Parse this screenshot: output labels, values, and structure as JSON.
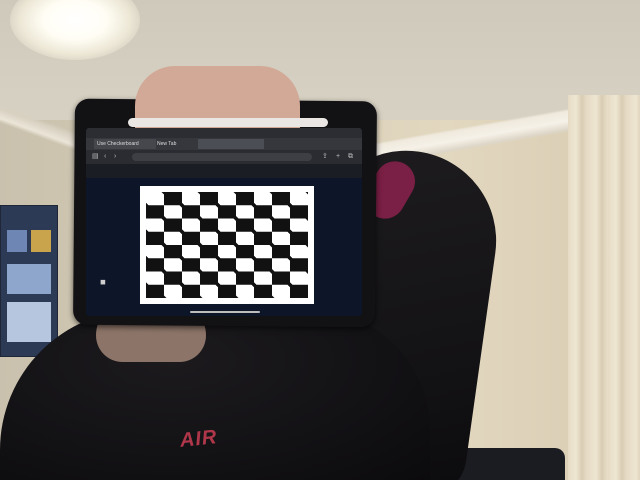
{
  "scene": {
    "description_text_visible": "",
    "shirt_logo_text": "AIR"
  },
  "tablet": {
    "browser": {
      "status_time": "",
      "tabs": [
        {
          "label": "Use Checkerboard"
        },
        {
          "label": "New Tab"
        },
        {
          "label": ""
        }
      ],
      "url": "",
      "page_title": ""
    }
  },
  "colors": {
    "wall": "#d9cfb8",
    "tablet_case": "#121114",
    "screen_bg": "#0d1628",
    "checker_dark": "#111111",
    "checker_light": "#ffffff"
  }
}
